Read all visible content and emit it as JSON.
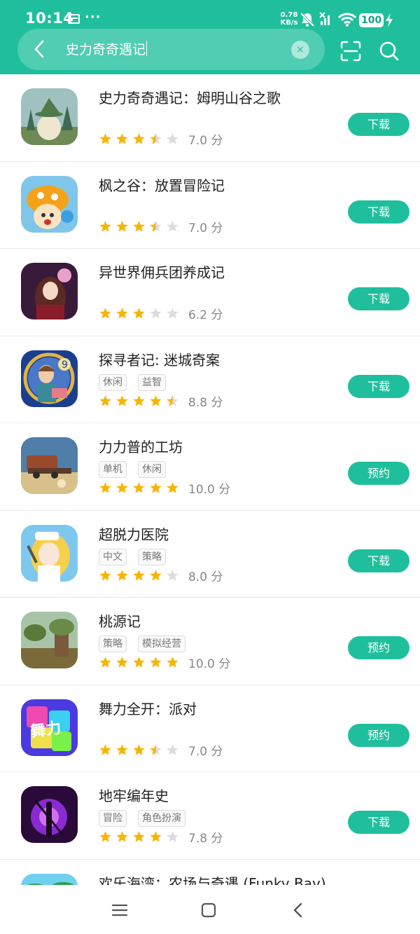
{
  "status_bar": {
    "time": "10:14",
    "dots": "···",
    "net_speed_value": "0.78",
    "net_speed_unit": "KB/s",
    "battery": "100"
  },
  "search": {
    "query": "史力奇奇遇记",
    "clear_symbol": "×"
  },
  "icons": {
    "back": "chevron-left-icon",
    "clear": "close-icon",
    "scan": "scan-icon",
    "search": "search-icon",
    "star": "star-icon"
  },
  "colors": {
    "brand": "#1fbf9d",
    "star": "#f7b500",
    "star_empty": "#dcdcdc"
  },
  "apps": [
    {
      "name": "史力奇奇遇记：姆明山谷之歌",
      "tags": [],
      "rating": 3.5,
      "score": "7.0 分",
      "action": "下载"
    },
    {
      "name": "枫之谷：放置冒险记",
      "tags": [],
      "rating": 3.5,
      "score": "7.0 分",
      "action": "下载"
    },
    {
      "name": "异世界佣兵团养成记",
      "tags": [],
      "rating": 3,
      "score": "6.2 分",
      "action": "下载"
    },
    {
      "name": "探寻者记: 迷城奇案",
      "tags": [
        "休闲",
        "益智"
      ],
      "rating": 4.5,
      "score": "8.8 分",
      "action": "下载"
    },
    {
      "name": "力力普的工坊",
      "tags": [
        "单机",
        "休闲"
      ],
      "rating": 5,
      "score": "10.0 分",
      "action": "预约"
    },
    {
      "name": "超脱力医院",
      "tags": [
        "中文",
        "策略"
      ],
      "rating": 4,
      "score": "8.0 分",
      "action": "下载"
    },
    {
      "name": "桃源记",
      "tags": [
        "策略",
        "模拟经营"
      ],
      "rating": 5,
      "score": "10.0 分",
      "action": "预约"
    },
    {
      "name": "舞力全开：派对",
      "tags": [],
      "rating": 3.5,
      "score": "7.0 分",
      "action": "预约"
    },
    {
      "name": "地牢编年史",
      "tags": [
        "冒险",
        "角色扮演"
      ],
      "rating": 4,
      "score": "7.8 分",
      "action": "下载"
    },
    {
      "name": "欢乐海湾：农场与奇遇 (Funky Bay)",
      "tags": [],
      "rating": 0,
      "score": "",
      "action": ""
    }
  ]
}
